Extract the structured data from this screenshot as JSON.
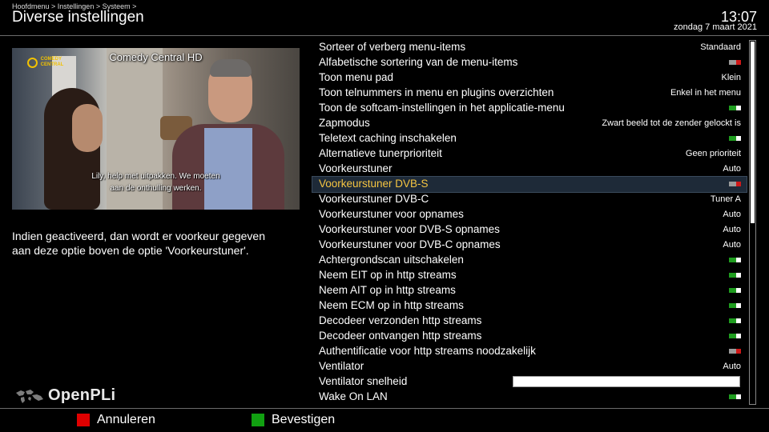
{
  "header": {
    "breadcrumb": "Hoofdmenu > Instellingen > Systeem >",
    "title": "Diverse instellingen",
    "clock": "13:07",
    "date": "zondag  7 maart 2021"
  },
  "preview": {
    "channel": "Comedy Central HD",
    "logo_line1": "COMEDY",
    "logo_line2": "CENTRAL",
    "subtitle_line1": "Lily, help met uitpakken. We moeten",
    "subtitle_line2": "aan de onthulling werken."
  },
  "description_line1": "Indien geactiveerd, dan wordt er voorkeur gegeven",
  "description_line2": "aan deze optie boven de optie 'Voorkeurstuner'.",
  "brand": {
    "name": "OpenPLi",
    "icon": "world-map-icon"
  },
  "items": [
    {
      "label": "Sorteer of verberg menu-items",
      "value": "Standaard"
    },
    {
      "label": "Alfabetische sortering van de menu-items",
      "toggle": "off"
    },
    {
      "label": "Toon menu pad",
      "value": "Klein"
    },
    {
      "label": "Toon telnummers in menu en plugins overzichten",
      "value": "Enkel in het menu"
    },
    {
      "label": "Toon de softcam-instellingen in het applicatie-menu",
      "toggle": "on"
    },
    {
      "label": "Zapmodus",
      "value": "Zwart beeld tot de zender gelockt is"
    },
    {
      "label": "Teletext caching inschakelen",
      "toggle": "on"
    },
    {
      "label": "Alternatieve tunerprioriteit",
      "value": "Geen prioriteit"
    },
    {
      "label": "Voorkeurstuner",
      "value": "Auto"
    },
    {
      "label": "Voorkeurstuner DVB-S",
      "toggle": "off",
      "selected": true
    },
    {
      "label": "Voorkeurstuner DVB-C",
      "value": "Tuner A"
    },
    {
      "label": "Voorkeurstuner voor opnames",
      "value": "Auto"
    },
    {
      "label": "Voorkeurstuner voor DVB-S opnames",
      "value": "Auto"
    },
    {
      "label": "Voorkeurstuner voor DVB-C opnames",
      "value": "Auto"
    },
    {
      "label": "Achtergrondscan uitschakelen",
      "toggle": "on"
    },
    {
      "label": "Neem EIT op in http streams",
      "toggle": "on"
    },
    {
      "label": "Neem AIT op in http streams",
      "toggle": "on"
    },
    {
      "label": "Neem ECM op in http streams",
      "toggle": "on"
    },
    {
      "label": "Decodeer verzonden http streams",
      "toggle": "on"
    },
    {
      "label": "Decodeer ontvangen http streams",
      "toggle": "on"
    },
    {
      "label": "Authentificatie voor http streams noodzakelijk",
      "toggle": "off"
    },
    {
      "label": "Ventilator",
      "value": "Auto"
    },
    {
      "label": "Ventilator snelheid",
      "slider": 1.0
    },
    {
      "label": "Wake On LAN",
      "toggle": "on"
    }
  ],
  "scroll_fraction": 0.5,
  "footer": {
    "red_label": "Annuleren",
    "green_label": "Bevestigen",
    "colors": {
      "red": "#e00000",
      "green": "#11a011",
      "selected_text": "#f5c542",
      "toggle_on": "#1f9d1f",
      "toggle_off": "#d01818"
    }
  }
}
